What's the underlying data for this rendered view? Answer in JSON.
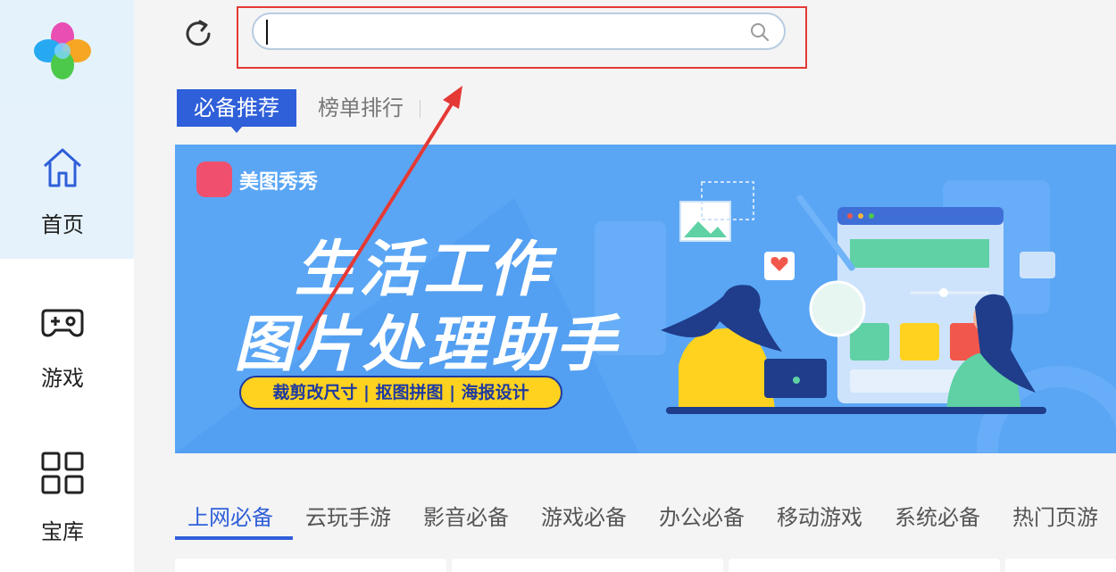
{
  "sidebar": {
    "logo": "app-logo",
    "items": [
      {
        "label": "首页",
        "icon": "home-icon",
        "active": true
      },
      {
        "label": "游戏",
        "icon": "gamepad-icon",
        "active": false
      },
      {
        "label": "宝库",
        "icon": "grid-icon",
        "active": false
      }
    ]
  },
  "search": {
    "value": "",
    "placeholder": ""
  },
  "tabs": [
    {
      "label": "必备推荐",
      "active": true
    },
    {
      "label": "榜单排行",
      "active": false
    }
  ],
  "banner": {
    "brand": "美图秀秀",
    "line1": "生活工作",
    "line2": "图片处理助手",
    "pill": "裁剪改尺寸 | 抠图拼图 | 海报设计"
  },
  "categories": [
    {
      "label": "上网必备",
      "active": true
    },
    {
      "label": "云玩手游",
      "active": false
    },
    {
      "label": "影音必备",
      "active": false
    },
    {
      "label": "游戏必备",
      "active": false
    },
    {
      "label": "办公必备",
      "active": false
    },
    {
      "label": "移动游戏",
      "active": false
    },
    {
      "label": "系统必备",
      "active": false
    },
    {
      "label": "热门页游",
      "active": false
    }
  ],
  "colors": {
    "accent": "#2f5fd9",
    "annotation": "#e53935",
    "banner_bg": "#5aa6f5",
    "pill": "#ffd21f"
  }
}
